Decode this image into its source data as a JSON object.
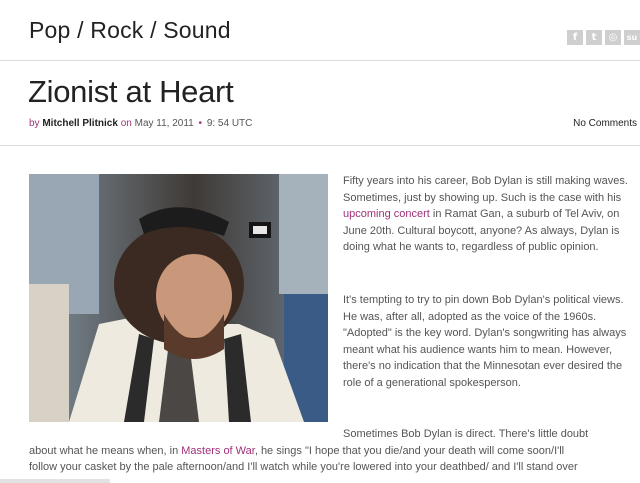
{
  "site": {
    "title": "Pop / Rock / Sound"
  },
  "social": [
    {
      "icon": "facebook-icon",
      "glyph": "f"
    },
    {
      "icon": "twitter-icon",
      "glyph": "t"
    },
    {
      "icon": "feed-icon",
      "glyph": "◎"
    },
    {
      "icon": "stumbleupon-icon",
      "glyph": "su"
    }
  ],
  "post": {
    "title": "Zionist at Heart",
    "meta": {
      "by": "by",
      "author": "Mitchell Plitnick",
      "on": "on",
      "date": "May 11, 2011",
      "separator": "•",
      "time": "9: 54 UTC"
    },
    "comments": "No Comments",
    "image_alt": "Bob Dylan wearing a kippah and tallit",
    "p1": {
      "a": "Fifty years into his career, Bob Dylan is still making waves. Sometimes, just by showing up. Such is the case with his ",
      "link": "upcoming concert",
      "b": " in Ramat Gan, a suburb of Tel Aviv, on June 20th. Cultural boycott, anyone? As always, Dylan is doing what he wants to, regardless of public opinion."
    },
    "p2": "It's tempting to try to pin down Bob Dylan's political views. He was, after all, adopted as the voice of the 1960s. \"Adopted\" is the key word. Dylan's songwriting has always meant what his audience wants him to mean. However, there's no indication that the Minnesotan ever desired the role of a generational spokesperson.",
    "p3": {
      "line1": "Sometimes Bob Dylan is direct. There's little doubt",
      "line2a": "about what he means when, in ",
      "link": "Masters of War",
      "line2b": ", he sings \"I hope that you die/and your death will come soon/I'll",
      "line3": "follow your casket by the pale afternoon/and I'll watch while you're lowered into your deathbed/ and I'll stand over"
    }
  }
}
